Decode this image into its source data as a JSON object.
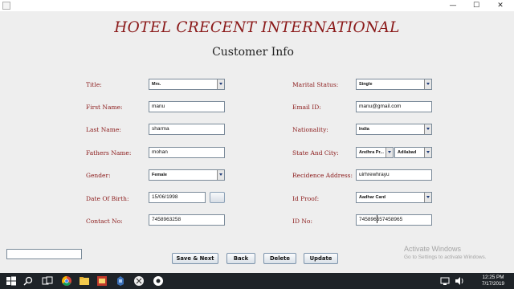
{
  "window": {
    "minimize": "—",
    "maximize": "☐",
    "close": "✕"
  },
  "form": {
    "hotel_title": "HOTEL CRECENT INTERNATIONAL",
    "page_title": "Customer Info",
    "left": {
      "title_label": "Title:",
      "title_value": "Mrs.",
      "first_name_label": "First Name:",
      "first_name_value": "manu",
      "last_name_label": "Last Name:",
      "last_name_value": "sharma",
      "fathers_name_label": "Fathers Name:",
      "fathers_name_value": "mohan",
      "gender_label": "Gender:",
      "gender_value": "Female",
      "dob_label": "Date Of Birth:",
      "dob_value": "15/06/1998",
      "contact_label": "Contact No:",
      "contact_value": "7458963258"
    },
    "right": {
      "marital_label": "Marital Status:",
      "marital_value": "Single",
      "email_label": "Email ID:",
      "email_value": "manu@gmail.com",
      "nationality_label": "Nationality:",
      "nationality_value": "India",
      "state_city_label": "State And City:",
      "state_value": "Andhra Pr...",
      "city_value": "Adilabad",
      "address_label": "Recidence Address:",
      "address_value": "uirhrewhrayu",
      "idproof_label": "Id Proof:",
      "idproof_value": "Aadhar Card",
      "idno_label": "ID No:",
      "idno_value": "745896557458965"
    },
    "buttons": {
      "save_next": "Save & Next",
      "back": "Back",
      "delete": "Delete",
      "update": "Update"
    }
  },
  "watermark": {
    "line1": "Activate Windows",
    "line2": "Go to Settings to activate Windows."
  },
  "taskbar": {
    "time": "12:25 PM",
    "date": "7/17/2019",
    "accent": "#7fb2e5",
    "icons": [
      "windows-start-icon",
      "search-icon",
      "task-view-icon",
      "chrome-icon",
      "file-explorer-icon",
      "ftp-icon",
      "java-icon",
      "virtualbox-icon",
      "app-icon",
      "clock-app-icon",
      "netbeans-icon"
    ]
  },
  "colors": {
    "label_red": "#8b1a1a",
    "background": "#eeeeee"
  }
}
